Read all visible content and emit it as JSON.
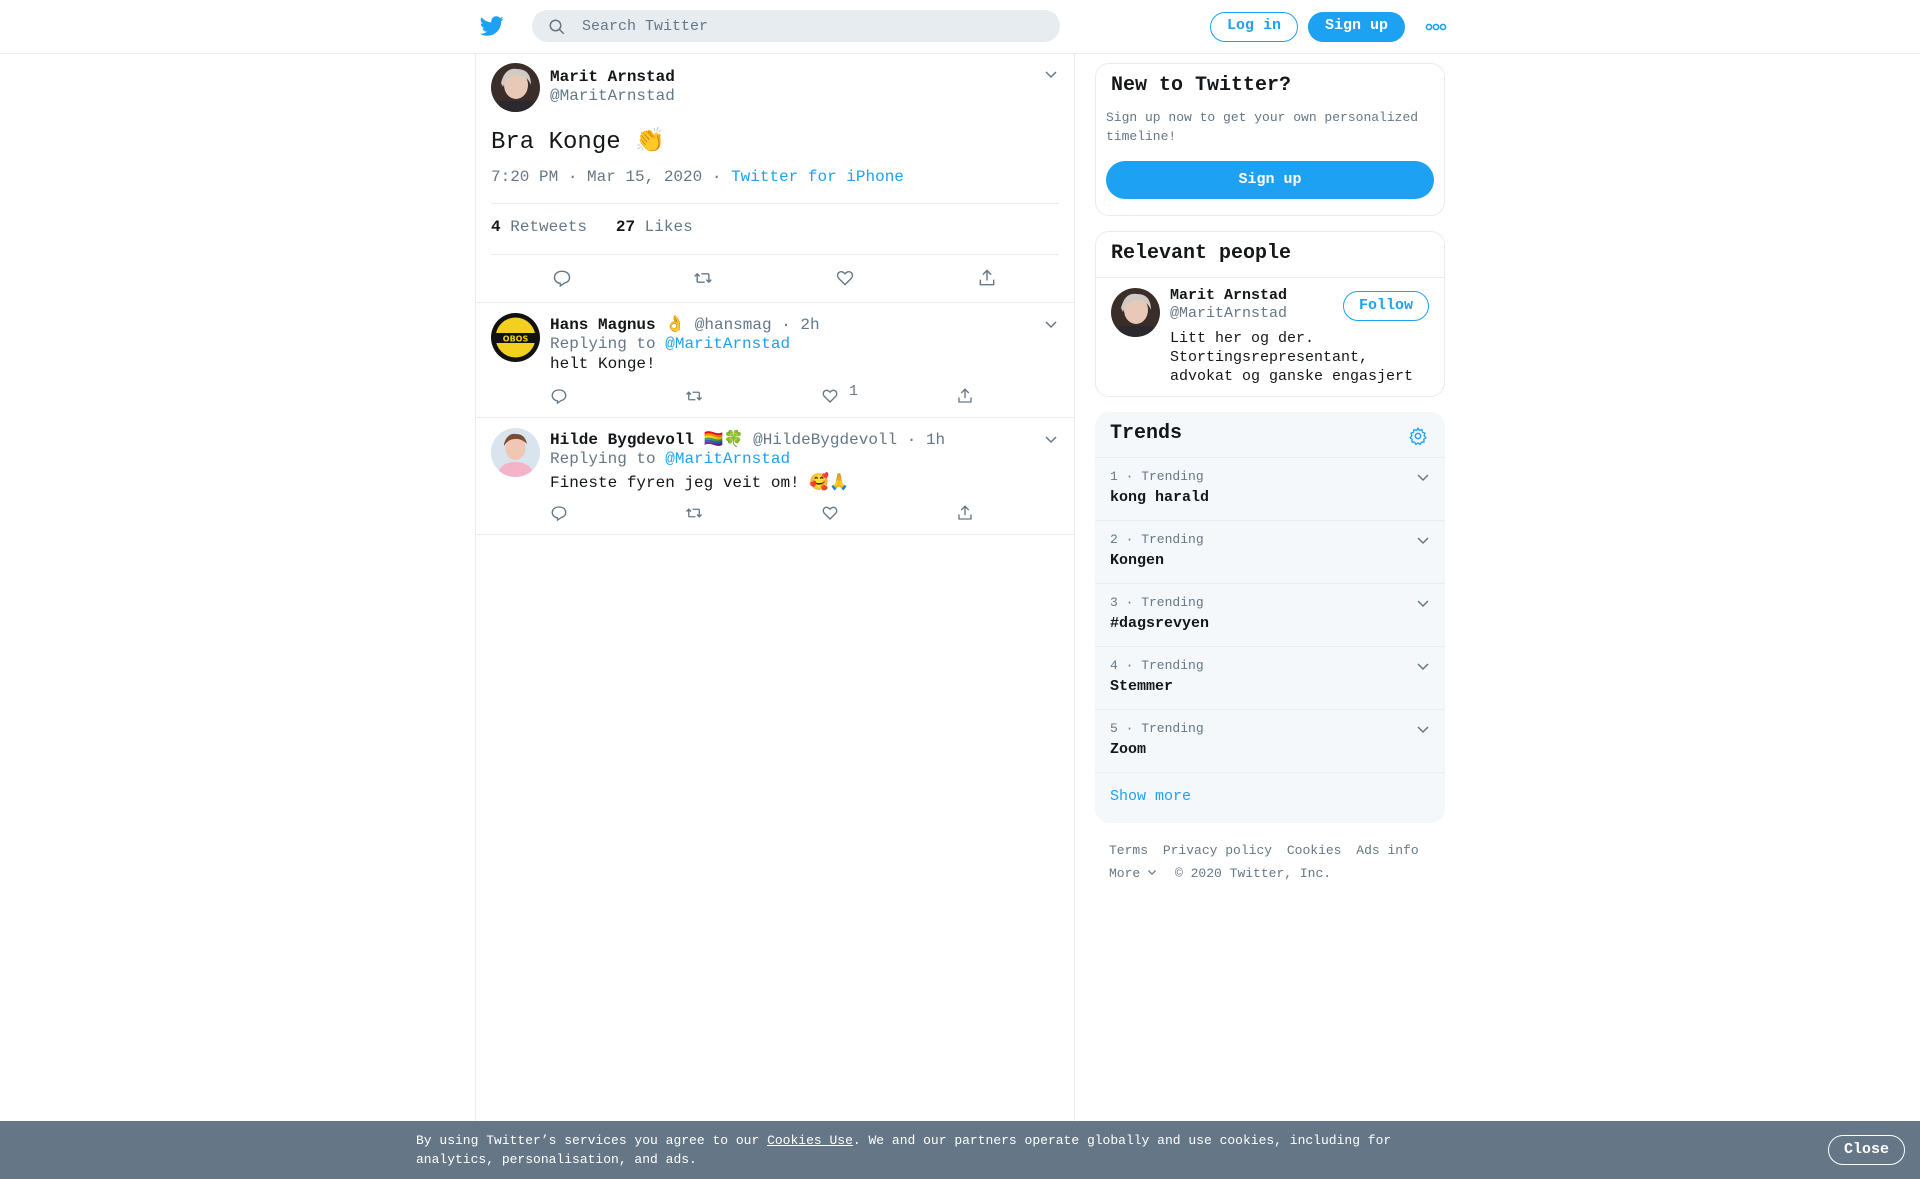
{
  "header": {
    "search_placeholder": "Search Twitter",
    "login_label": "Log in",
    "signup_label": "Sign up"
  },
  "focal_tweet": {
    "author_name": "Marit Arnstad",
    "author_handle": "@MaritArnstad",
    "text": "Bra Konge 👏",
    "time": "7:20 PM · Mar 15, 2020",
    "source_sep": "·",
    "source": "Twitter for iPhone",
    "retweets_count": "4",
    "retweets_label": "Retweets",
    "likes_count": "27",
    "likes_label": "Likes"
  },
  "replies": [
    {
      "author_name": "Hans Magnus",
      "author_emoji": "👌",
      "author_handle": "@hansmag",
      "age": "· 2h",
      "replying_prefix": "Replying to",
      "replying_to": "@MaritArnstad",
      "text": "helt Konge!",
      "like_count": "1",
      "avatar_text": "OBOS"
    },
    {
      "author_name": "Hilde Bygdevoll",
      "author_emoji": "🏳️‍🌈🍀",
      "author_handle": "@HildeBygdevoll",
      "age": "· 1h",
      "replying_prefix": "Replying to",
      "replying_to": "@MaritArnstad",
      "text": "Fineste fyren jeg veit om! 🥰🙏",
      "like_count": ""
    }
  ],
  "new_to_twitter": {
    "title": "New to Twitter?",
    "text": "Sign up now to get your own personalized timeline!",
    "signup_label": "Sign up"
  },
  "relevant_people": {
    "title": "Relevant people",
    "person": {
      "name": "Marit Arnstad",
      "handle": "@MaritArnstad",
      "bio": "Litt her og der. Stortingsrepresentant, advokat og ganske engasjert",
      "follow_label": "Follow"
    }
  },
  "trends": {
    "title": "Trends",
    "items": [
      {
        "rank": "1 · Trending",
        "label": "kong harald"
      },
      {
        "rank": "2 · Trending",
        "label": "Kongen"
      },
      {
        "rank": "3 · Trending",
        "label": "#dagsrevyen"
      },
      {
        "rank": "4 · Trending",
        "label": "Stemmer"
      },
      {
        "rank": "5 · Trending",
        "label": "Zoom"
      }
    ],
    "show_more": "Show more"
  },
  "footer": {
    "links": [
      "Terms",
      "Privacy policy",
      "Cookies",
      "Ads info"
    ],
    "more_label": "More",
    "copyright": "© 2020 Twitter, Inc."
  },
  "cookie_banner": {
    "prefix": "By using Twitter’s services you agree to our",
    "link": "Cookies Use",
    "suffix": ". We and our partners operate globally and use cookies, including for analytics, personalisation, and ads.",
    "close_label": "Close"
  },
  "colors": {
    "accent": "#1da1f2",
    "muted": "#657786",
    "border": "#e6ecf0",
    "banner": "#657786"
  }
}
